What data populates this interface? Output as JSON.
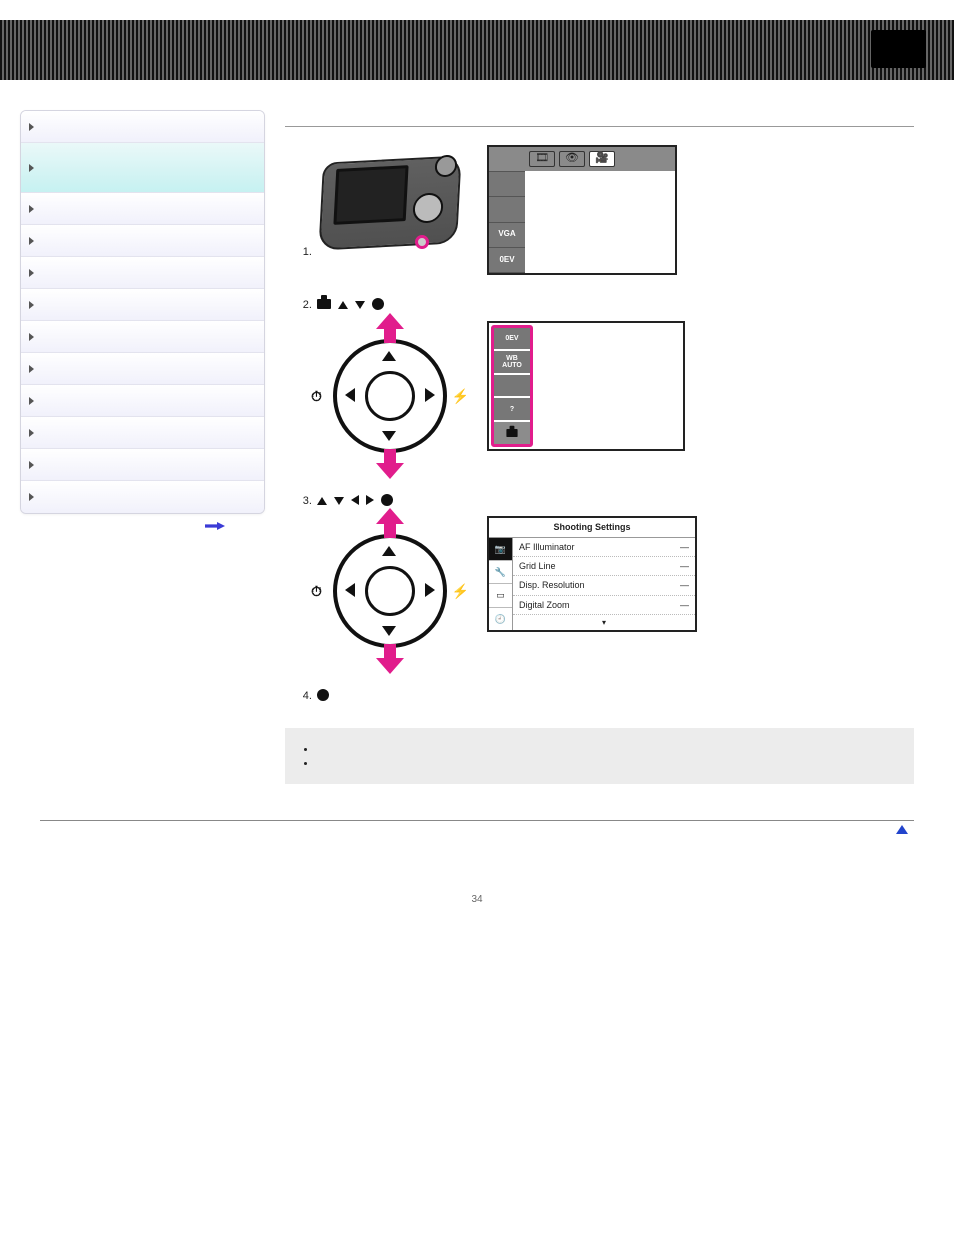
{
  "header": {
    "tab_label": ""
  },
  "sidebar": {
    "items": [
      {
        "label": "",
        "active": false
      },
      {
        "label": "",
        "active": true
      },
      {
        "label": "",
        "active": false
      },
      {
        "label": "",
        "active": false
      },
      {
        "label": "",
        "active": false
      },
      {
        "label": "",
        "active": false
      },
      {
        "label": "",
        "active": false
      },
      {
        "label": "",
        "active": false
      },
      {
        "label": "",
        "active": false
      },
      {
        "label": "",
        "active": false
      },
      {
        "label": "",
        "active": false
      },
      {
        "label": "",
        "active": false
      }
    ],
    "next_label": ""
  },
  "main": {
    "breadcrumbs": "",
    "title": "",
    "lead": "",
    "steps": {
      "s1": {
        "text_before": "",
        "text_after": ""
      },
      "s2": {
        "prefix": "",
        "toolbox_word": "",
        "mid": "",
        "suffix": ""
      },
      "s3": {
        "prefix": "",
        "suffix": ""
      },
      "s4": {
        "prefix": "",
        "suffix": ""
      }
    },
    "lcd1_left": [
      "",
      "",
      "",
      "",
      "0EV"
    ],
    "lcd2_left": [
      "0EV",
      "WB\nAUTO",
      "",
      "?",
      ""
    ],
    "settings_box": {
      "title": "Shooting Settings",
      "rows": [
        {
          "name": "AF Illuminator",
          "value": "—"
        },
        {
          "name": "Grid Line",
          "value": "—"
        },
        {
          "name": "Disp. Resolution",
          "value": "—"
        },
        {
          "name": "Digital Zoom",
          "value": "—"
        }
      ]
    },
    "notes": {
      "heading": "",
      "items": [
        "",
        ""
      ]
    }
  },
  "footer": {
    "gotop": "",
    "pagenum": "34"
  },
  "icons": {
    "timer": "⏱",
    "flash": "⚡",
    "camera": "📷",
    "wrench": "🔧",
    "rect": "▭",
    "clock": "🕘",
    "film": "🎞",
    "eye": "👁",
    "vga": "VGA"
  }
}
